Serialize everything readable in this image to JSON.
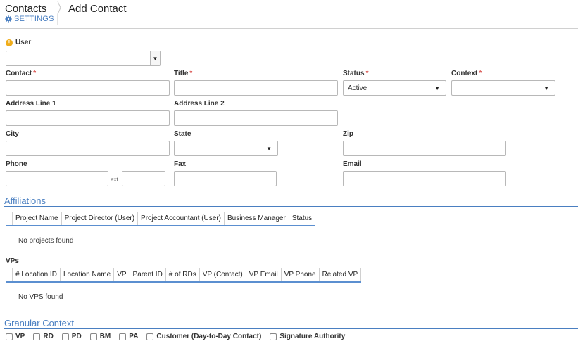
{
  "header": {
    "title": "Contacts",
    "settings_label": "SETTINGS",
    "page_title": "Add Contact"
  },
  "form": {
    "user_label": "User",
    "user_value": "",
    "contact_label": "Contact",
    "title_label": "Title",
    "status_label": "Status",
    "status_value": "Active",
    "context_label": "Context",
    "context_value": "",
    "address1_label": "Address Line 1",
    "address2_label": "Address Line 2",
    "city_label": "City",
    "state_label": "State",
    "state_value": "",
    "zip_label": "Zip",
    "phone_label": "Phone",
    "ext_label": "ext.",
    "fax_label": "Fax",
    "email_label": "Email",
    "required_mark": "*"
  },
  "affiliations": {
    "title": "Affiliations",
    "columns": [
      "Project Name",
      "Project Director (User)",
      "Project Accountant (User)",
      "Business Manager",
      "Status"
    ],
    "empty_text": "No projects found"
  },
  "vps": {
    "title": "VPs",
    "columns": [
      "# Location ID",
      "Location Name",
      "VP",
      "Parent ID",
      "# of RDs",
      "VP (Contact)",
      "VP Email",
      "VP Phone",
      "Related VP"
    ],
    "empty_text": "No VPS found"
  },
  "granular": {
    "title": "Granular Context",
    "options": [
      "VP",
      "RD",
      "PD",
      "BM",
      "PA",
      "Customer (Day-to-Day Contact)",
      "Signature Authority"
    ]
  },
  "colors": {
    "accent": "#4a7fc1",
    "required": "#d9534f",
    "info": "#f0ad1a"
  }
}
